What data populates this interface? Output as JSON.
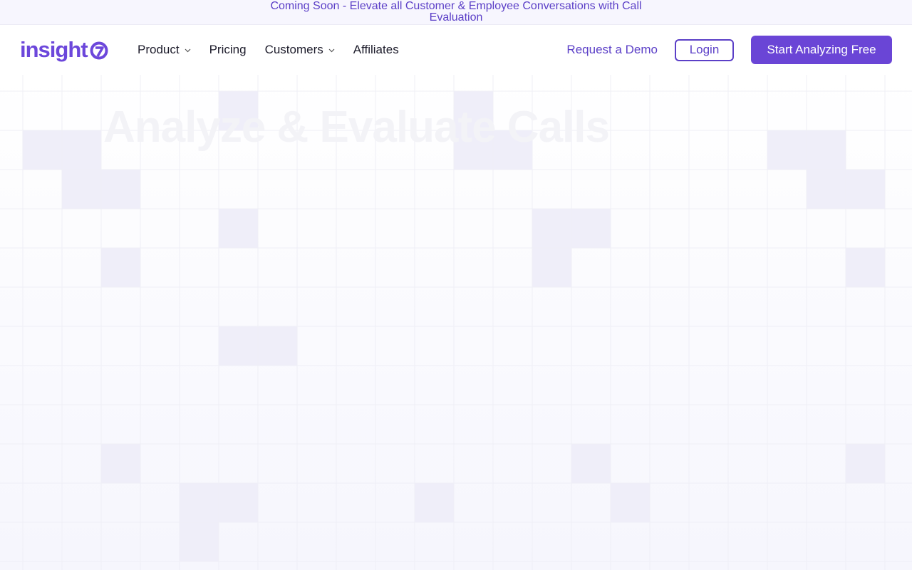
{
  "announcement": {
    "text": "Coming Soon - Elevate all Customer & Employee Conversations with Call Evaluation"
  },
  "brand": {
    "name": "insight",
    "color": "#6c47db"
  },
  "nav": {
    "items": [
      {
        "label": "Product",
        "has_dropdown": true
      },
      {
        "label": "Pricing",
        "has_dropdown": false
      },
      {
        "label": "Customers",
        "has_dropdown": true
      },
      {
        "label": "Affiliates",
        "has_dropdown": false
      }
    ],
    "request_demo": "Request a Demo",
    "login": "Login",
    "cta": "Start Analyzing Free"
  },
  "hero": {
    "title": "Analyze & Evaluate Calls"
  },
  "colors": {
    "accent": "#6a45d6",
    "text": "#1d1c2b",
    "grid_line": "#efeff6",
    "grid_highlight": "#efeef9"
  }
}
